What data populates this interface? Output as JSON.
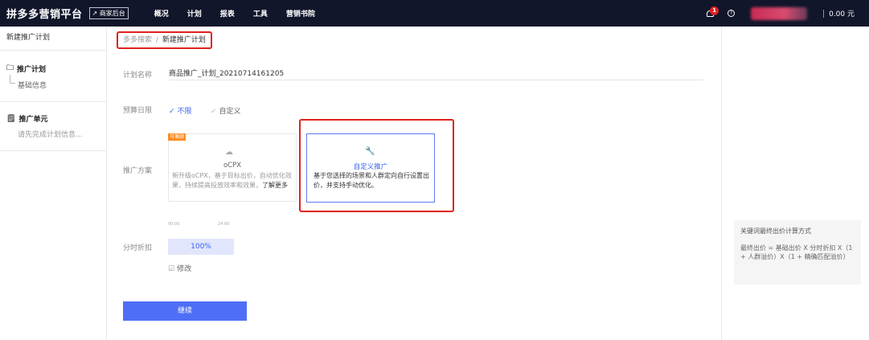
{
  "topbar": {
    "logo": "拼多多营销平台",
    "merchant_link": "↗ 商家后台",
    "nav": [
      "概况",
      "计划",
      "报表",
      "工具",
      "营销书院"
    ],
    "notification_count": "1",
    "help_icon": "?",
    "balance": "0.00 元"
  },
  "sidebar": {
    "title": "新建推广计划",
    "plan_group": {
      "label": "推广计划",
      "sub": "基础信息"
    },
    "unit_group": {
      "label": "推广单元",
      "sub": "请先完成计划信息..."
    }
  },
  "breadcrumb": {
    "parent": "多多搜索",
    "separator": "/",
    "current": "新建推广计划"
  },
  "form": {
    "plan_name_label": "计划名称",
    "plan_name_value": "商品推广_计划_20210714161205",
    "budget_label": "预算日限",
    "budget_options": [
      "不限",
      "自定义"
    ],
    "budget_selected": "不限",
    "scheme_label": "推广方案",
    "ocpx_card": {
      "tag": "可兼顾",
      "title": "oCPX",
      "desc": "新升级oCPX，基于目标出价，自动优化效果，持续提高投放效率和效果，",
      "learn_more": "了解更多"
    },
    "custom_card": {
      "title": "自定义推广",
      "desc": "基于您选择的场景和人群定向自行设置出价，并支持手动优化。"
    },
    "time_start": "00:00",
    "time_end": "24:00",
    "discount_label": "分时折扣",
    "discount_value": "100%",
    "modify_label": "修改",
    "continue_label": "继续"
  },
  "right_panel": {
    "formula_title": "关键词最终出价计算方式",
    "formula_text": "最终出价 = 基础出价 X 分时折扣 X（1 + 人群溢价）X（1 + 精确匹配溢价）"
  },
  "colors": {
    "topbar_bg": "#11162b",
    "accent": "#3e63f0",
    "primary_button": "#4f6ef7",
    "highlight_frame": "#e0231e"
  }
}
